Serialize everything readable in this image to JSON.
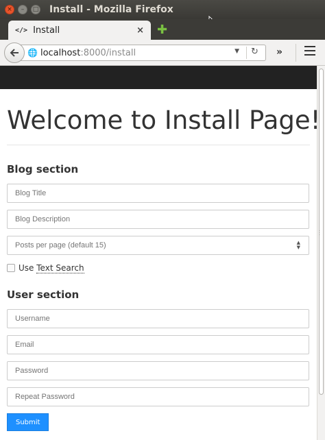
{
  "window": {
    "title": "Install - Mozilla Firefox"
  },
  "tab": {
    "icon_glyph": "</>",
    "label": "Install",
    "close_glyph": "×",
    "new_tab_glyph": "✚"
  },
  "nav": {
    "back_glyph": "🡐",
    "url_host": "localhost",
    "url_rest": ":8000/install",
    "dropdown_glyph": "▼",
    "reload_glyph": "↻",
    "overflow_glyph": "»"
  },
  "page": {
    "title": "Welcome to Install Page!",
    "blog_section": {
      "title": "Blog section",
      "blog_title_placeholder": "Blog Title",
      "blog_description_placeholder": "Blog Description",
      "posts_per_page_placeholder": "Posts per page (default 15)",
      "use_label": "Use ",
      "text_search_label": "Text Search"
    },
    "user_section": {
      "title": "User section",
      "username_placeholder": "Username",
      "email_placeholder": "Email",
      "password_placeholder": "Password",
      "repeat_password_placeholder": "Repeat Password"
    },
    "submit_label": "Submit"
  },
  "colors": {
    "page_navbar": "#222222",
    "submit_button": "#1e90ff"
  }
}
